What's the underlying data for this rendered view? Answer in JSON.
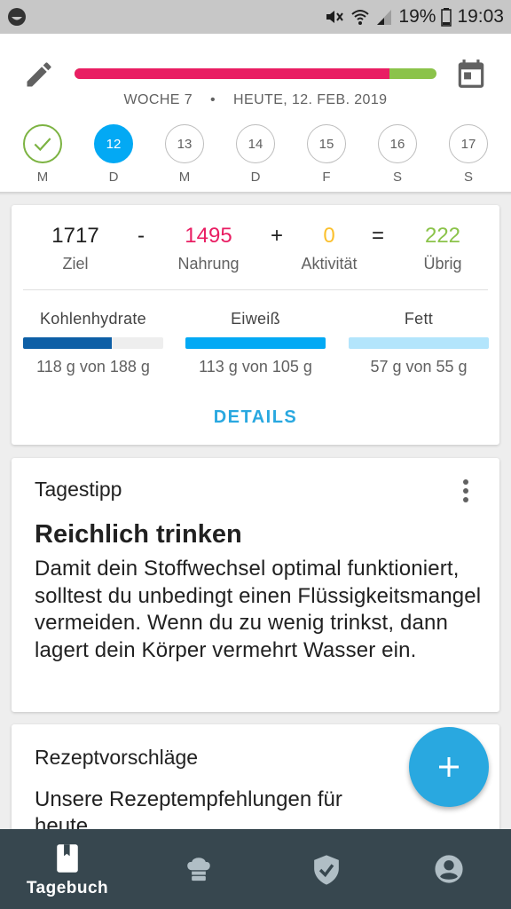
{
  "status_bar": {
    "battery": "19%",
    "time": "19:03"
  },
  "header": {
    "week": "WOCHE 7",
    "separator": "•",
    "date": "HEUTE, 12. FEB. 2019",
    "progress_fraction": 0.87,
    "colors": {
      "consumed": "#e91e63",
      "remaining": "#8bc34a"
    }
  },
  "days": [
    {
      "label": "M",
      "number": "",
      "state": "done"
    },
    {
      "label": "D",
      "number": "12",
      "state": "active"
    },
    {
      "label": "M",
      "number": "13",
      "state": "future"
    },
    {
      "label": "D",
      "number": "14",
      "state": "future"
    },
    {
      "label": "F",
      "number": "15",
      "state": "future"
    },
    {
      "label": "S",
      "number": "16",
      "state": "future"
    },
    {
      "label": "S",
      "number": "17",
      "state": "future"
    }
  ],
  "summary": {
    "goal": {
      "value": "1717",
      "label": "Ziel"
    },
    "minus": "-",
    "food": {
      "value": "1495",
      "label": "Nahrung",
      "color": "#e91e63"
    },
    "plus": "+",
    "activity": {
      "value": "0",
      "label": "Aktivität",
      "color": "#fbc02d"
    },
    "equals": "=",
    "remaining": {
      "value": "222",
      "label": "Übrig",
      "color": "#8bc34a"
    },
    "macros": [
      {
        "name": "Kohlenhydrate",
        "value": "118 g von 188 g",
        "fraction": 0.63,
        "color": "#0d5fa6"
      },
      {
        "name": "Eiweiß",
        "value": "113 g von 105 g",
        "fraction": 1.0,
        "color": "#03a9f4"
      },
      {
        "name": "Fett",
        "value": "57 g von 55 g",
        "fraction": 1.0,
        "color": "#b3e5fc"
      }
    ],
    "details_label": "DETAILS"
  },
  "tip": {
    "header": "Tagestipp",
    "title": "Reichlich trinken",
    "body": "Damit dein Stoffwechsel optimal funktioniert, solltest du unbedingt einen Flüssigkeitsmangel vermeiden. Wenn du zu wenig trinkst, dann lagert dein Körper vermehrt Wasser ein."
  },
  "recipes": {
    "header": "Rezeptvorschläge",
    "body": "Unsere Rezeptempfehlungen für heute."
  },
  "bottom_nav": {
    "items": [
      {
        "icon": "diary-icon",
        "label": "Tagebuch",
        "active": true
      },
      {
        "icon": "chef-hat-icon",
        "label": "",
        "active": false
      },
      {
        "icon": "shield-check-icon",
        "label": "",
        "active": false
      },
      {
        "icon": "profile-icon",
        "label": "",
        "active": false
      }
    ]
  }
}
